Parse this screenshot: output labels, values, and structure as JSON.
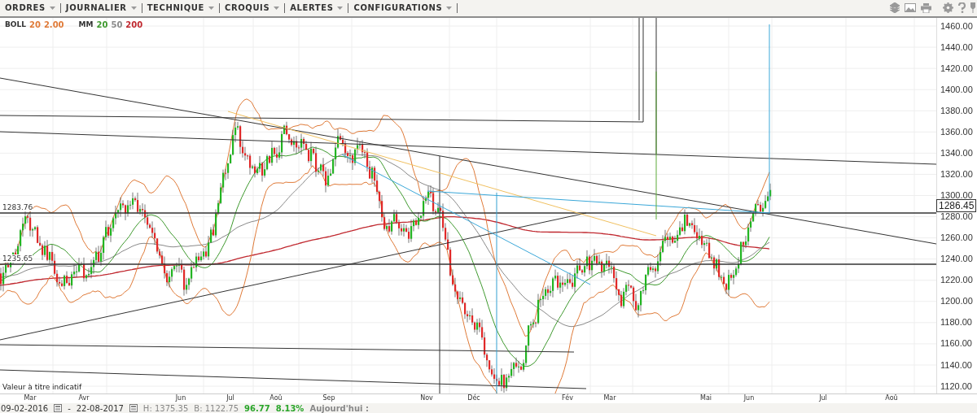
{
  "menu": [
    {
      "label": "ORDRES"
    },
    {
      "label": "JOURNALIER"
    },
    {
      "label": "TECHNIQUE"
    },
    {
      "label": "CROQUIS"
    },
    {
      "label": "ALERTES"
    },
    {
      "label": "CONFIGURATIONS"
    }
  ],
  "legend": [
    {
      "name": "BOLL",
      "params": [
        {
          "text": "20",
          "color": "#e07b39"
        },
        {
          "text": "2.00",
          "color": "#e07b39"
        }
      ]
    },
    {
      "name": "MM",
      "params": [
        {
          "text": "20",
          "color": "#3f9a2f"
        },
        {
          "text": "50",
          "color": "#8a8a8a"
        },
        {
          "text": "200",
          "color": "#c0282f"
        }
      ]
    }
  ],
  "price_axis": {
    "ticks": [
      "1460.00",
      "1440.00",
      "1420.00",
      "1400.00",
      "1380.00",
      "1360.00",
      "1340.00",
      "1320.00",
      "1300.00",
      "1280.00",
      "1260.00",
      "1240.00",
      "1220.00",
      "1200.00",
      "1180.00",
      "1160.00",
      "1140.00",
      "1120.00"
    ],
    "current_price": "1286.45"
  },
  "level_labels": [
    "1283.76",
    "1235.65"
  ],
  "note": "Valeur à titre indicatif",
  "time_axis": [
    "Mar",
    "Avr",
    "Jun",
    "Jul",
    "Aoû",
    "Sep",
    "Nov",
    "Déc",
    "Fév",
    "Mar",
    "Mai",
    "Jun",
    "Jul",
    "Aoû"
  ],
  "range": {
    "from": "09-02-2016",
    "separator": "-",
    "to": "22-08-2017"
  },
  "stats": {
    "high": "H: 1375.35",
    "low": "B: 1122.75",
    "change": "96.77",
    "change_pct": "8.13%",
    "today": "Aujourd'hui :"
  }
}
